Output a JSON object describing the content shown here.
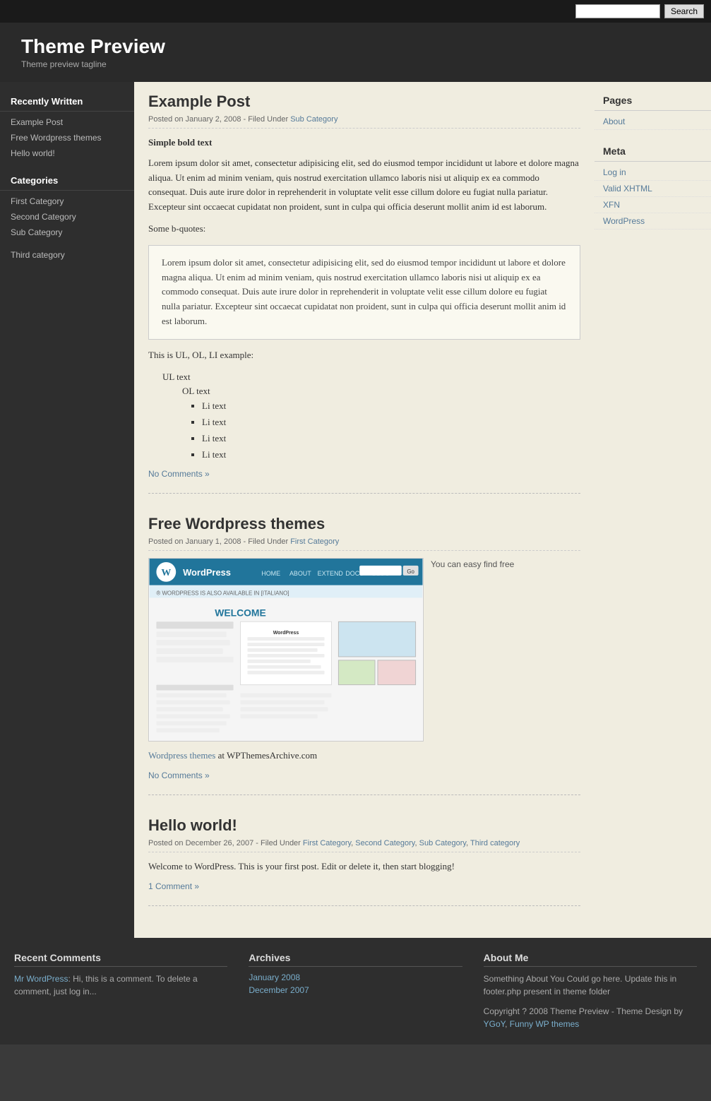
{
  "topbar": {
    "search_placeholder": "",
    "search_button": "Search"
  },
  "header": {
    "site_title": "Theme Preview",
    "tagline": "Theme preview tagline"
  },
  "left_sidebar": {
    "recently_written_title": "Recently Written",
    "links": [
      {
        "label": "Example Post",
        "href": "#"
      },
      {
        "label": "Free Wordpress themes",
        "href": "#"
      },
      {
        "label": "Hello world!",
        "href": "#"
      }
    ],
    "categories_title": "Categories",
    "categories": [
      {
        "label": "First Category",
        "href": "#"
      },
      {
        "label": "Second Category",
        "href": "#"
      },
      {
        "label": "Sub Category",
        "href": "#"
      },
      {
        "label": "Third category",
        "href": "#"
      }
    ]
  },
  "posts": [
    {
      "title": "Example Post",
      "meta": "Posted on January 2, 2008 - Filed Under",
      "meta_link_text": "Sub Category",
      "bold_text": "Simple bold text",
      "paragraph": "Lorem ipsum dolor sit amet, consectetur adipisicing elit, sed do eiusmod tempor incididunt ut labore et dolore magna aliqua. Ut enim ad minim veniam, quis nostrud exercitation ullamco laboris nisi ut aliquip ex ea commodo consequat. Duis aute irure dolor in reprehenderit in voluptate velit esse cillum dolore eu fugiat nulla pariatur. Excepteur sint occaecat cupidatat non proident, sunt in culpa qui officia deserunt mollit anim id est laborum.",
      "bquote_label": "Some b-quotes:",
      "blockquote": "Lorem ipsum dolor sit amet, consectetur adipisicing elit, sed do eiusmod tempor incididunt ut labore et dolore magna aliqua. Ut enim ad minim veniam, quis nostrud exercitation ullamco laboris nisi ut aliquip ex ea commodo consequat. Duis aute irure dolor in reprehenderit in voluptate velit esse cillum dolore eu fugiat nulla pariatur. Excepteur sint occaecat cupidatat non proident, sunt in culpa qui officia deserunt mollit anim id est laborum.",
      "list_label": "This is UL, OL, LI example:",
      "ul_text": "UL text",
      "ol_text": "OL text",
      "li_items": [
        "Li text",
        "Li text",
        "Li text",
        "Li text"
      ],
      "no_comments": "No Comments »"
    },
    {
      "title": "Free Wordpress themes",
      "meta": "Posted on January 1, 2008 - Filed Under",
      "meta_link_text": "First Category",
      "image_caption": "You can easy find free",
      "wp_themes_link": "Wordpress themes",
      "wp_themes_suffix": " at WPThemesArchive.com",
      "no_comments": "No Comments »"
    },
    {
      "title": "Hello world!",
      "meta": "Posted on December 26, 2007 - Filed Under",
      "meta_links": [
        "First Category",
        "Second Category",
        "Sub Category",
        "Third category"
      ],
      "paragraph": "Welcome to WordPress. This is your first post. Edit or delete it, then start blogging!",
      "comments": "1 Comment »"
    }
  ],
  "right_sidebar": {
    "pages_title": "Pages",
    "pages_links": [
      {
        "label": "About",
        "href": "#"
      }
    ],
    "meta_title": "Meta",
    "meta_links": [
      {
        "label": "Log in",
        "href": "#"
      },
      {
        "label": "Valid XHTML",
        "href": "#"
      },
      {
        "label": "XFN",
        "href": "#"
      },
      {
        "label": "WordPress",
        "href": "#"
      }
    ]
  },
  "footer": {
    "recent_comments_title": "Recent Comments",
    "comment_author": "Mr WordPress",
    "comment_text": ": Hi, this is a comment. To delete a comment, just log in...",
    "archives_title": "Archives",
    "archive_links": [
      {
        "label": "January 2008",
        "href": "#"
      },
      {
        "label": "December 2007",
        "href": "#"
      }
    ],
    "about_title": "About Me",
    "about_text": "Something About You Could go here. Update this in footer.php present in theme folder",
    "copyright": "Copyright ? 2008 Theme Preview - Theme Design by",
    "ygoY_link": "YGoY",
    "funny_link": "Funny WP themes",
    "themes_label": "themes"
  }
}
